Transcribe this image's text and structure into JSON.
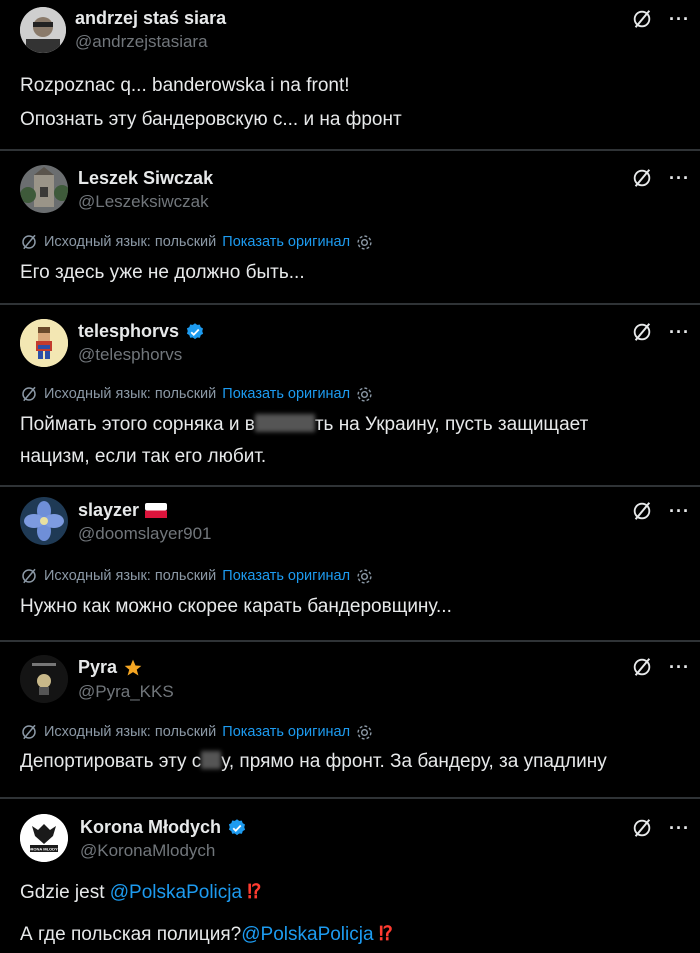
{
  "posts": [
    {
      "name": "andrzej staś siara",
      "handle": "@andrzejstasiara",
      "lines": [
        "Rozpoznac q... banderowska i na front!",
        "Опознать эту бандеровскую с... и на фронт"
      ]
    },
    {
      "name": "Leszek Siwczak",
      "handle": "@Leszeksiwczak",
      "translation_label": "Исходный язык: польский",
      "show_original": "Показать оригинал",
      "text": "Его здесь уже не должно быть..."
    },
    {
      "name": "telesphorvs",
      "handle": "@telesphorvs",
      "translation_label": "Исходный язык: польский",
      "show_original": "Показать оригинал",
      "text_a": "Поймать этого сорняка и в",
      "text_b": "ть на Украину, пусть защищает",
      "text_c": "нацизм, если так его любит."
    },
    {
      "name": "slayzer",
      "handle": "@doomslayer901",
      "translation_label": "Исходный язык: польский",
      "show_original": "Показать оригинал",
      "text": "Нужно как можно скорее карать бандеровщину..."
    },
    {
      "name": "Pyra",
      "handle": "@Pyra_KKS",
      "translation_label": "Исходный язык: польский",
      "show_original": "Показать оригинал",
      "text_a": "Депортировать эту с",
      "text_b": "у, прямо на фронт. За бандеру, за упадлину"
    },
    {
      "name": "Korona Młodych",
      "handle": "@KoronaMlodych",
      "line1_text": "Gdzie jest ",
      "line1_mention": "@PolskaPolicja",
      "line2_text": "А где польская полиция?",
      "line2_mention": "@PolskaPolicja",
      "exclamation": "⁉",
      "avatar_label": "KORONA MŁODYCH"
    }
  ],
  "icons": {
    "more": "more-options-icon",
    "grok": "grok-icon",
    "verified": "verified-badge-icon",
    "translate": "translate-icon",
    "settings": "settings-gear-icon",
    "flag": "poland-flag-icon",
    "star": "star-icon"
  },
  "colors": {
    "accent": "#1d9bf0",
    "muted": "#71767b",
    "background": "#000000"
  }
}
